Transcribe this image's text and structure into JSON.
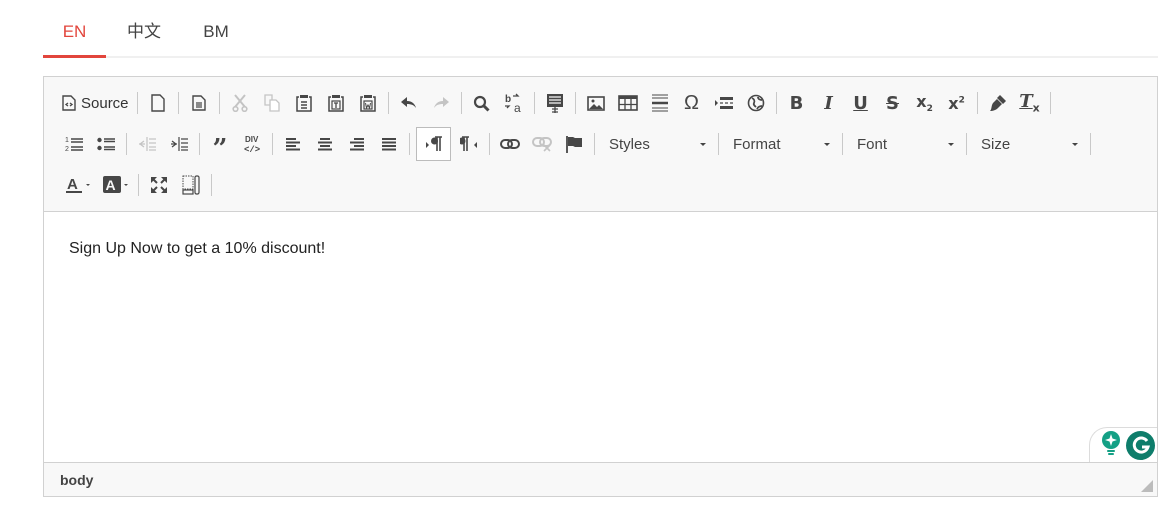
{
  "language_tabs": [
    {
      "label": "EN",
      "active": true
    },
    {
      "label": "中文",
      "active": false
    },
    {
      "label": "BM",
      "active": false
    }
  ],
  "toolbar": {
    "source_label": "Source",
    "combos": {
      "styles": "Styles",
      "format": "Format",
      "font": "Font",
      "size": "Size"
    },
    "buttons": [
      "source-icon",
      "new-page-icon",
      "preview-icon",
      "cut-icon",
      "copy-icon",
      "paste-icon",
      "paste-text-icon",
      "paste-word-icon",
      "undo-icon",
      "redo-icon",
      "find-icon",
      "replace-icon",
      "select-all-icon",
      "image-icon",
      "table-icon",
      "horizontal-line-icon",
      "special-char-icon",
      "page-break-icon",
      "iframe-icon",
      "bold-icon",
      "italic-icon",
      "underline-icon",
      "strike-icon",
      "subscript-icon",
      "superscript-icon",
      "copy-format-icon",
      "remove-format-icon",
      "numbered-list-icon",
      "bulleted-list-icon",
      "outdent-icon",
      "indent-icon",
      "blockquote-icon",
      "div-icon",
      "align-left-icon",
      "align-center-icon",
      "align-right-icon",
      "justify-icon",
      "ltr-icon",
      "rtl-icon",
      "link-icon",
      "unlink-icon",
      "anchor-icon",
      "text-color-icon",
      "bg-color-icon",
      "maximize-icon",
      "show-blocks-icon"
    ]
  },
  "content": {
    "text": "Sign Up Now to get a 10% discount!"
  },
  "status_bar": {
    "path": "body"
  },
  "colors": {
    "accent": "#e2453c",
    "grammarly": "#0e7d6b"
  }
}
